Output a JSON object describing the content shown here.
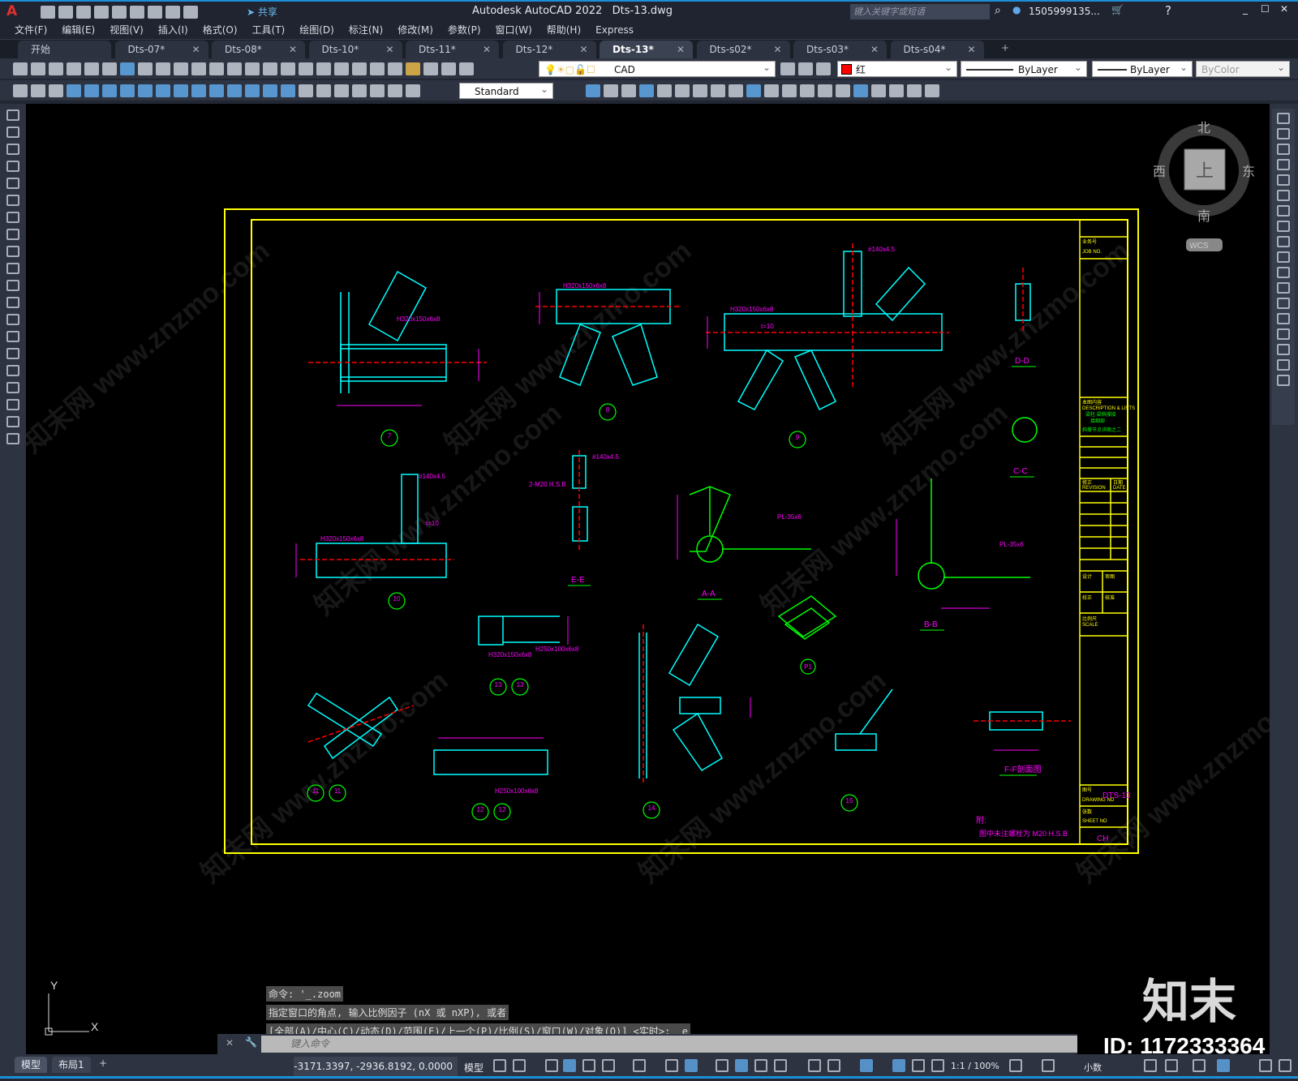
{
  "titlebar": {
    "app_title": "Autodesk AutoCAD 2022",
    "file": "Dts-13.dwg",
    "share": "共享",
    "search_placeholder": "键入关键字或短语",
    "user": "1505999135...",
    "app_icon": "A"
  },
  "menu": [
    "文件(F)",
    "编辑(E)",
    "视图(V)",
    "插入(I)",
    "格式(O)",
    "工具(T)",
    "绘图(D)",
    "标注(N)",
    "修改(M)",
    "参数(P)",
    "窗口(W)",
    "帮助(H)",
    "Express"
  ],
  "tabs": [
    {
      "label": "开始"
    },
    {
      "label": "Dts-07*"
    },
    {
      "label": "Dts-08*"
    },
    {
      "label": "Dts-10*"
    },
    {
      "label": "Dts-11*"
    },
    {
      "label": "Dts-12*"
    },
    {
      "label": "Dts-13*",
      "active": true
    },
    {
      "label": "Dts-s02*"
    },
    {
      "label": "Dts-s03*"
    },
    {
      "label": "Dts-s04*"
    }
  ],
  "properties": {
    "layer": "CAD",
    "color": "红",
    "color_hex": "#ff0000",
    "linetype": "ByLayer",
    "lineweight": "ByLayer",
    "plotstyle": "ByColor",
    "dimstyle": "Standard"
  },
  "viewcube": {
    "north": "北",
    "south": "南",
    "east": "东",
    "west": "西",
    "face": "上",
    "wcs": "WCS"
  },
  "ucs": {
    "x": "X",
    "y": "Y"
  },
  "drawing": {
    "labels": [
      "D-D",
      "C-C",
      "E-E",
      "A-A",
      "B-B",
      "F-F剖面图",
      "P1"
    ],
    "bubbles": [
      "7",
      "8",
      "9",
      "10",
      "13",
      "11",
      "12",
      "14",
      "15"
    ],
    "dims": [
      "H320x150x6x8",
      "H250x100x6x8",
      "t=10",
      "#140x4.5",
      "2-M20 H.S.B",
      "PL-35x6"
    ],
    "note_title": "附:",
    "note": "图中未注螺栓为  M20 H.S.B",
    "titleblock": {
      "job": "业务号",
      "job_en": "JOB NO.",
      "desc": "本图内容",
      "desc_en": "DESCRIPTION & LISTS",
      "desc1": "梁柱.梁斜撑接",
      "desc2": "接细部",
      "desc3": "斜撑节点详图之二",
      "revision": "修正",
      "revision_en": "REVISION",
      "date": "日期",
      "date_en": "DATE",
      "designed": "设计",
      "checked": "校正",
      "drawn": "审图",
      "approved": "核准",
      "scale": "比例尺",
      "scale_en": "SCALE",
      "drawing_no_label": "图号",
      "drawing_no_en": "DRAWING NO",
      "drawing_no": "DTS-13",
      "sheet": "张数",
      "sheet_en": "SHEET NO",
      "ch": "CH"
    }
  },
  "command": {
    "history": [
      "命令: '_.zoom",
      "指定窗口的角点, 输入比例因子 (nX 或 nXP), 或者",
      "[全部(A)/中心(C)/动态(D)/范围(E)/上一个(P)/比例(S)/窗口(W)/对象(O)] <实时>: _e"
    ],
    "placeholder": "键入命令"
  },
  "status": {
    "model_tab": "模型",
    "layout_tab": "布局1",
    "coords": "-3171.3397, -2936.8192, 0.0000",
    "space": "模型",
    "scale": "1:1 / 100%",
    "units": "小数"
  },
  "watermark": {
    "text": "知末网 www.znzmo.com",
    "logo": "知末",
    "id": "ID: 1172333364"
  },
  "colors": {
    "frame": "#ffff00",
    "steel": "#00ffff",
    "dim": "#ff00ff",
    "red": "#ff0000",
    "green": "#00ff00"
  }
}
